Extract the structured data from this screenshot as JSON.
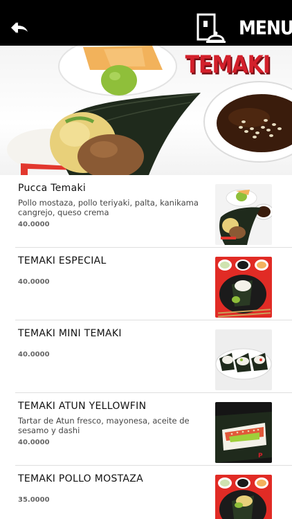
{
  "header": {
    "back_icon": "back-arrow-icon",
    "menu_icon": "menu-cloche-icon",
    "menu_label": "MENU"
  },
  "hero": {
    "title": "TEMAKI"
  },
  "items": [
    {
      "name": "Pucca Temaki",
      "description": "Pollo mostaza, pollo teriyaki, palta, kanikama cangrejo, queso crema",
      "price": "40.0000"
    },
    {
      "name": "TEMAKI ESPECIAL",
      "description": "",
      "price": "40.0000"
    },
    {
      "name": "TEMAKI MINI TEMAKI",
      "description": "",
      "price": "40.0000"
    },
    {
      "name": "TEMAKI ATUN YELLOWFIN",
      "description": "Tartar de Atun fresco, mayonesa, aceite de sesamo y dashi",
      "price": "40.0000"
    },
    {
      "name": "TEMAKI POLLO MOSTAZA",
      "description": "",
      "price": "35.0000"
    }
  ],
  "colors": {
    "topbar": "#000000",
    "title_red": "#d3202b",
    "divider": "#dedede"
  }
}
